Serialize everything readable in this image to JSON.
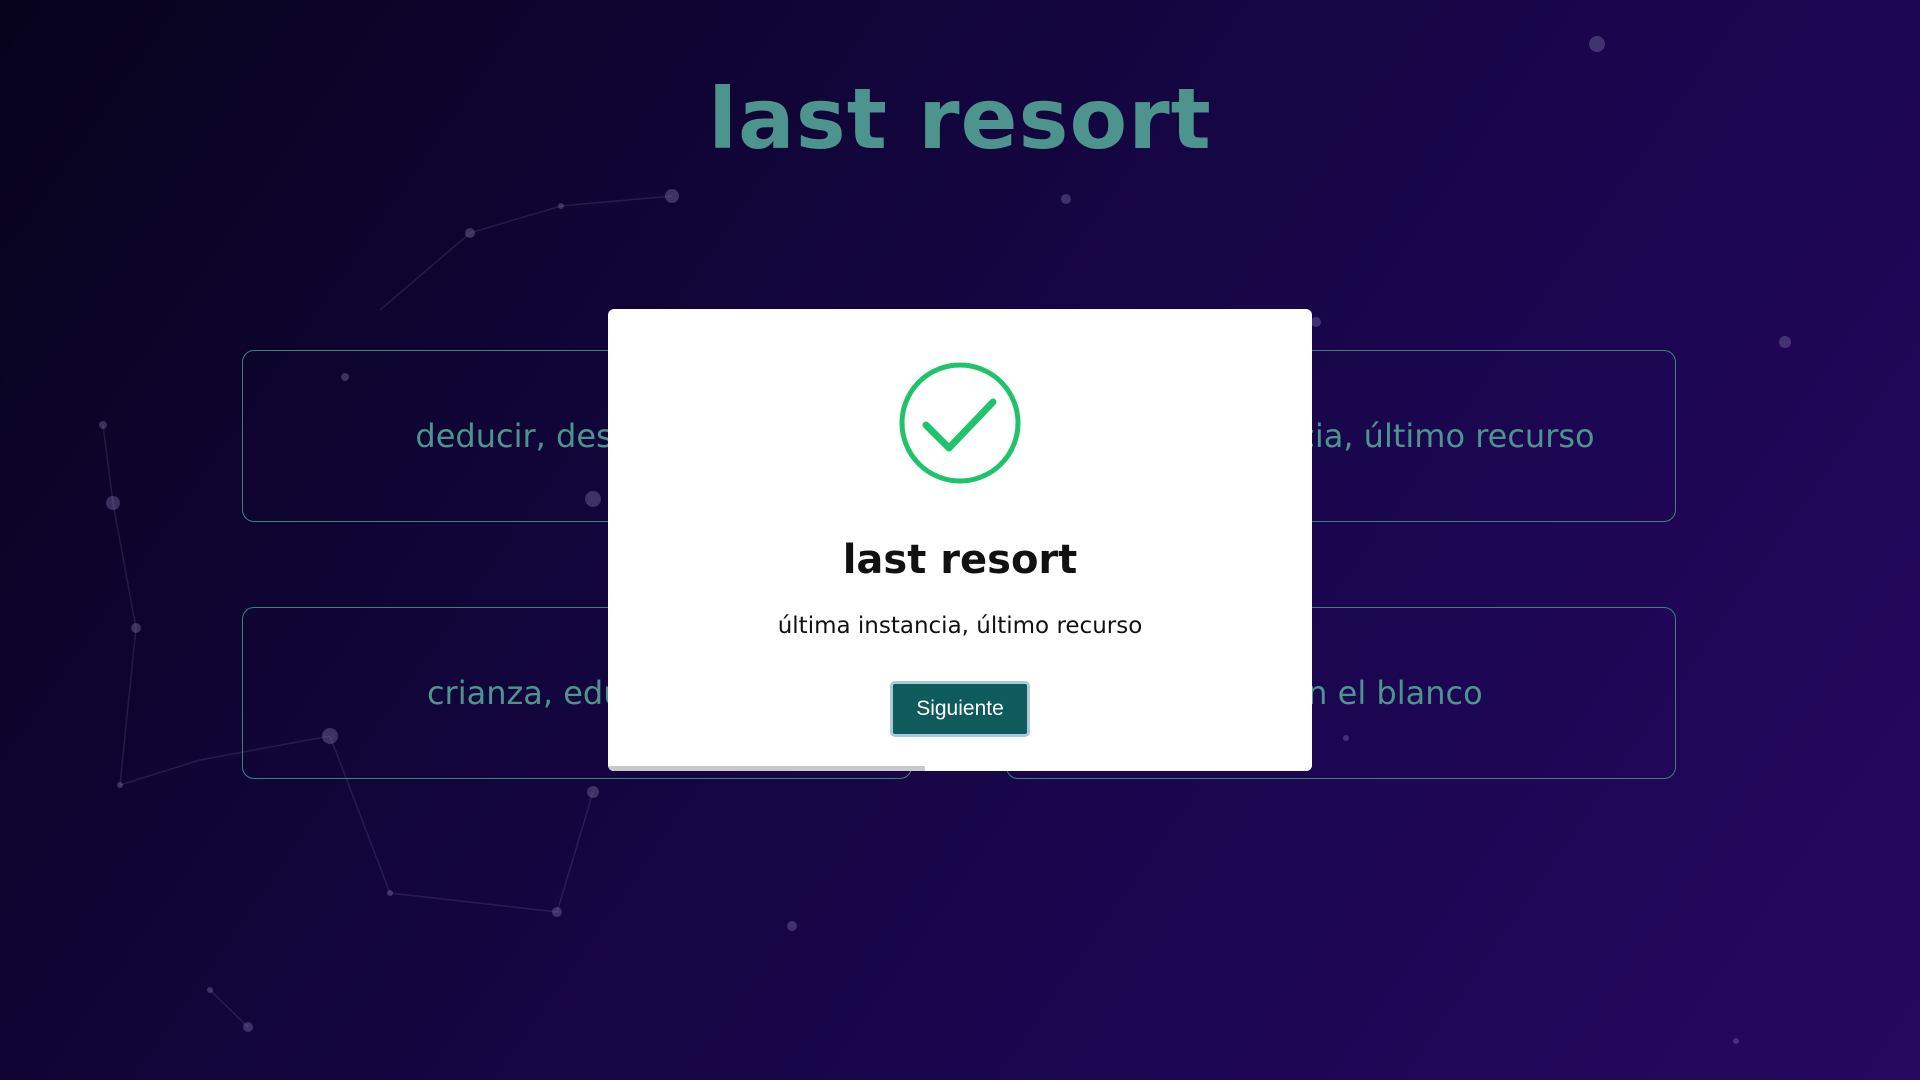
{
  "page": {
    "title": "last resort"
  },
  "options": [
    {
      "label": "deducir, desprender"
    },
    {
      "label": "última instancia, último recurso"
    },
    {
      "label": "crianza, educación"
    },
    {
      "label": "justo en el blanco"
    }
  ],
  "modal": {
    "icon": "check-circle-icon",
    "term": "last resort",
    "translation": "última instancia, último recurso",
    "next_label": "Siguiente",
    "progress": 0.45
  },
  "colors": {
    "accent_teal": "#4e948e",
    "success_green": "#1fc46a",
    "button_bg": "#0f5b5b"
  }
}
